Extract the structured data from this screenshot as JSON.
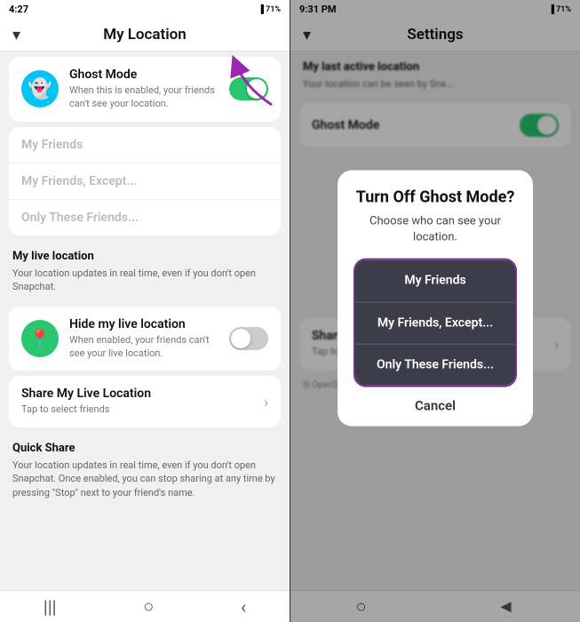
{
  "left": {
    "status_bar": {
      "time": "4:27",
      "icons": "◄ ✉ ⊕ ▣"
    },
    "nav": {
      "back_icon": "▾",
      "title": "My Location"
    },
    "ghost_mode": {
      "icon_char": "👻",
      "title": "Ghost Mode",
      "subtitle": "When this is enabled, your friends can't see your location.",
      "toggle_state": "on"
    },
    "friends_options": {
      "option1": "My Friends",
      "option2": "My Friends, Except...",
      "option3": "Only These Friends..."
    },
    "section_live": {
      "label": "My live location",
      "sublabel": "Your location updates in real time, even if you don't open Snapchat."
    },
    "hide_live": {
      "title": "Hide my live location",
      "subtitle": "When enabled, your friends can't see your live location.",
      "toggle_state": "off"
    },
    "share_live": {
      "title": "Share My Live Location",
      "subtitle": "Tap to select friends"
    },
    "section_quick": {
      "label": "Quick Share",
      "sublabel": "Your location updates in real time, even if you don't open Snapchat. Once enabled, you can stop sharing at any time by pressing \"Stop\" next to your friend's name."
    }
  },
  "right": {
    "status_bar": {
      "time": "9:31 PM",
      "icons": "✉ ⊕ ▣ 71%"
    },
    "nav": {
      "back_icon": "▾",
      "title": "Settings"
    },
    "section_last": {
      "label": "My last active location",
      "sublabel": "Your location can be seen by Sna..."
    },
    "modal": {
      "title": "Turn Off Ghost Mode?",
      "subtitle": "Choose who can see your location.",
      "option1": "My Friends",
      "option2": "My Friends, Except...",
      "option3": "Only These Friends...",
      "cancel": "Cancel"
    },
    "share_live": {
      "title": "Share My Live",
      "subtitle": "Tap to select friends"
    },
    "footer": "© OpenStreetMap, © Maxar and other data providers"
  }
}
